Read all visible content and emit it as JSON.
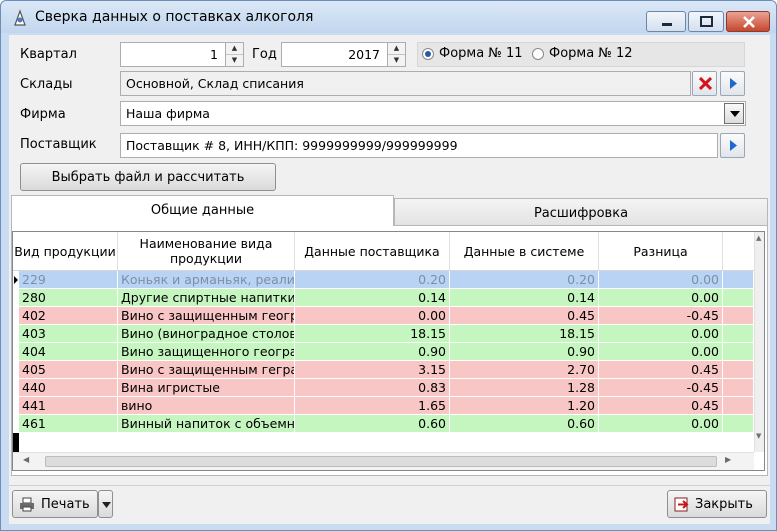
{
  "window": {
    "title": "Сверка данных о поставках алкоголя"
  },
  "form": {
    "quarter_label": "Квартал",
    "quarter_value": "1",
    "year_label": "Год",
    "year_value": "2017",
    "form11_label": "Форма № 11",
    "form12_label": "Форма № 12",
    "form_selected": "Форма № 11",
    "warehouses_label": "Склады",
    "warehouses_value": "Основной, Склад списания",
    "firm_label": "Фирма",
    "firm_value": "Наша фирма",
    "supplier_label": "Поставщик",
    "supplier_value": "Поставщик # 8, ИНН/КПП: 9999999999/999999999",
    "calc_button": "Выбрать файл и рассчитать"
  },
  "tabs": [
    {
      "label": "Общие данные",
      "active": true
    },
    {
      "label": "Расшифровка",
      "active": false
    }
  ],
  "table": {
    "headers": [
      "Вид продукции",
      "Наименование вида продукции",
      "Данные поставщика",
      "Данные в системе",
      "Разница"
    ],
    "rows": [
      {
        "code": "229",
        "name": "Коньяк и арманьяк, реализу",
        "supplier": "0.20",
        "system": "0.20",
        "diff": "0.00",
        "status": "selected"
      },
      {
        "code": "280",
        "name": "Другие спиртные напитки с",
        "supplier": "0.14",
        "system": "0.14",
        "diff": "0.00",
        "status": "ok"
      },
      {
        "code": "402",
        "name": "Вино с защищенным геогра",
        "supplier": "0.00",
        "system": "0.45",
        "diff": "-0.45",
        "status": "mismatch"
      },
      {
        "code": "403",
        "name": "Вино (виноградное столово",
        "supplier": "18.15",
        "system": "18.15",
        "diff": "0.00",
        "status": "ok"
      },
      {
        "code": "404",
        "name": "Вино защищенного географ",
        "supplier": "0.90",
        "system": "0.90",
        "diff": "0.00",
        "status": "ok"
      },
      {
        "code": "405",
        "name": "Вино с защищенным геграф",
        "supplier": "3.15",
        "system": "2.70",
        "diff": "0.45",
        "status": "mismatch"
      },
      {
        "code": "440",
        "name": "Вина игристые",
        "supplier": "0.83",
        "system": "1.28",
        "diff": "-0.45",
        "status": "mismatch"
      },
      {
        "code": "441",
        "name": "вино",
        "supplier": "1.65",
        "system": "1.20",
        "diff": "0.45",
        "status": "mismatch"
      },
      {
        "code": "461",
        "name": "Винный напиток с объемно",
        "supplier": "0.60",
        "system": "0.60",
        "diff": "0.00",
        "status": "ok"
      }
    ]
  },
  "footer": {
    "print_button": "Печать",
    "close_button": "Закрыть"
  },
  "colors": {
    "ok": "#c6f6c0",
    "mismatch": "#f9c6c6",
    "selected": "#b8d3f4",
    "selected_text": "#7d8fa8"
  }
}
